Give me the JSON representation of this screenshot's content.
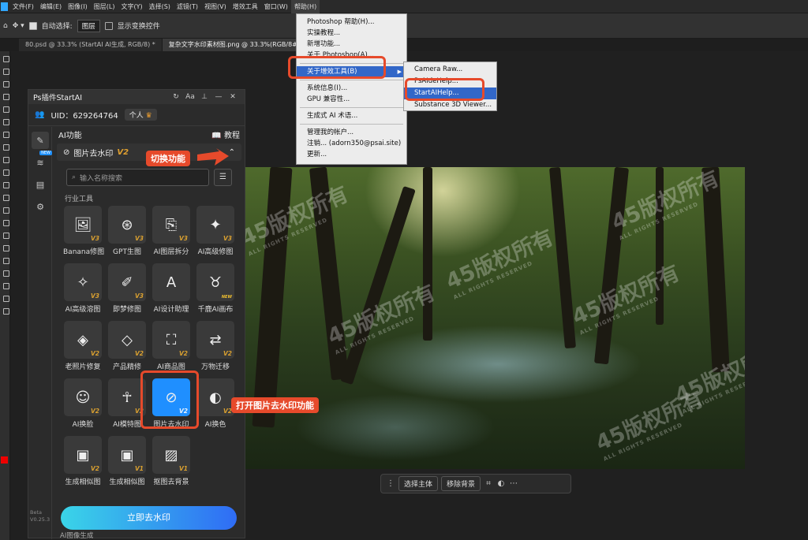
{
  "menubar": {
    "items": [
      "文件(F)",
      "编辑(E)",
      "图像(I)",
      "图层(L)",
      "文字(Y)",
      "选择(S)",
      "滤镜(T)",
      "视图(V)",
      "增效工具",
      "窗口(W)",
      "帮助(H)"
    ]
  },
  "options_bar": {
    "auto_select_label": "自动选择:",
    "auto_select_value": "图层",
    "transform_label": "显示变换控件"
  },
  "tabs": [
    "80.psd @ 33.3% (StartAI AI生成, RGB/8) *",
    "复杂文字水印素材图.png @ 33.3%(RGB/8#)"
  ],
  "help_menu": {
    "items": [
      "Photoshop 帮助(H)...",
      "实操教程...",
      "新增功能...",
      "关于 Photoshop(A)...",
      "关于增效工具(B)",
      "系统信息(I)...",
      "GPU 兼容性...",
      "生成式 AI 术语...",
      "管理我的帐户...",
      "注销... (adorn350@psai.site)",
      "更新..."
    ],
    "highlighted": "关于增效工具(B)"
  },
  "submenu": {
    "items": [
      "Camera Raw...",
      "PsAIdeHelp...",
      "StartAIHelp...",
      "Substance 3D Viewer..."
    ],
    "highlighted": "StartAIHelp..."
  },
  "plugin": {
    "title": "Ps插件StartAI",
    "uid": "UID：629264764",
    "account_badge": "个人",
    "section_title": "AI功能",
    "tutorial": "教程",
    "feature_selected": "图片去水印",
    "feature_version": "V2",
    "search_placeholder": "输入名称搜索",
    "category": "行业工具",
    "side_new": "NEW",
    "tiles": [
      {
        "label": "Banana修图",
        "ver": "V3",
        "icon": "image-edit-icon"
      },
      {
        "label": "GPT生图",
        "ver": "V3",
        "icon": "gpt-icon"
      },
      {
        "label": "AI图层拆分",
        "ver": "V3",
        "icon": "layer-split-icon"
      },
      {
        "label": "AI高级修图",
        "ver": "V3",
        "icon": "magic-wand-icon"
      },
      {
        "label": "AI高级溶图",
        "ver": "V3",
        "icon": "image-sparkle-icon"
      },
      {
        "label": "即梦修图",
        "ver": "V3",
        "icon": "dream-brush-icon"
      },
      {
        "label": "AI设计助理",
        "ver": "",
        "icon": "design-assistant-icon"
      },
      {
        "label": "千鹿AI画布",
        "ver": "NEW",
        "icon": "deer-icon"
      },
      {
        "label": "老照片修复",
        "ver": "V2",
        "icon": "photo-repair-icon"
      },
      {
        "label": "产品精修",
        "ver": "V2",
        "icon": "diamond-icon"
      },
      {
        "label": "AI商品图",
        "ver": "V2",
        "icon": "shopping-bag-icon"
      },
      {
        "label": "万物迁移",
        "ver": "V2",
        "icon": "transfer-icon"
      },
      {
        "label": "AI换脸",
        "ver": "V2",
        "icon": "face-icon"
      },
      {
        "label": "AI模特图",
        "ver": "V2",
        "icon": "model-icon"
      },
      {
        "label": "图片去水印",
        "ver": "V2",
        "icon": "watermark-remove-icon"
      },
      {
        "label": "AI换色",
        "ver": "V2",
        "icon": "color-change-icon"
      },
      {
        "label": "生成相似图",
        "ver": "V2",
        "icon": "similar-image-icon"
      },
      {
        "label": "生成相似图",
        "ver": "V1",
        "icon": "similar-image-icon"
      },
      {
        "label": "抠图去背景",
        "ver": "V1",
        "icon": "cutout-icon"
      }
    ],
    "selected_tile_index": 14,
    "gen_section": "AI图像生成",
    "action_button": "立即去水印",
    "beta_label": "Beta",
    "version_label": "V0.25.3"
  },
  "context_bar": {
    "select_subject": "选择主体",
    "remove_bg": "移除背景"
  },
  "annotations": {
    "switch_feature": "切换功能",
    "open_feature": "打开图片去水印功能"
  },
  "watermark_text": "45版权所有",
  "watermark_sub": "ALL RIGHTS RESERVED",
  "colors": {
    "accent": "#1f8fff",
    "annotation": "#e64a2b",
    "menu_highlight": "#3267c8"
  }
}
